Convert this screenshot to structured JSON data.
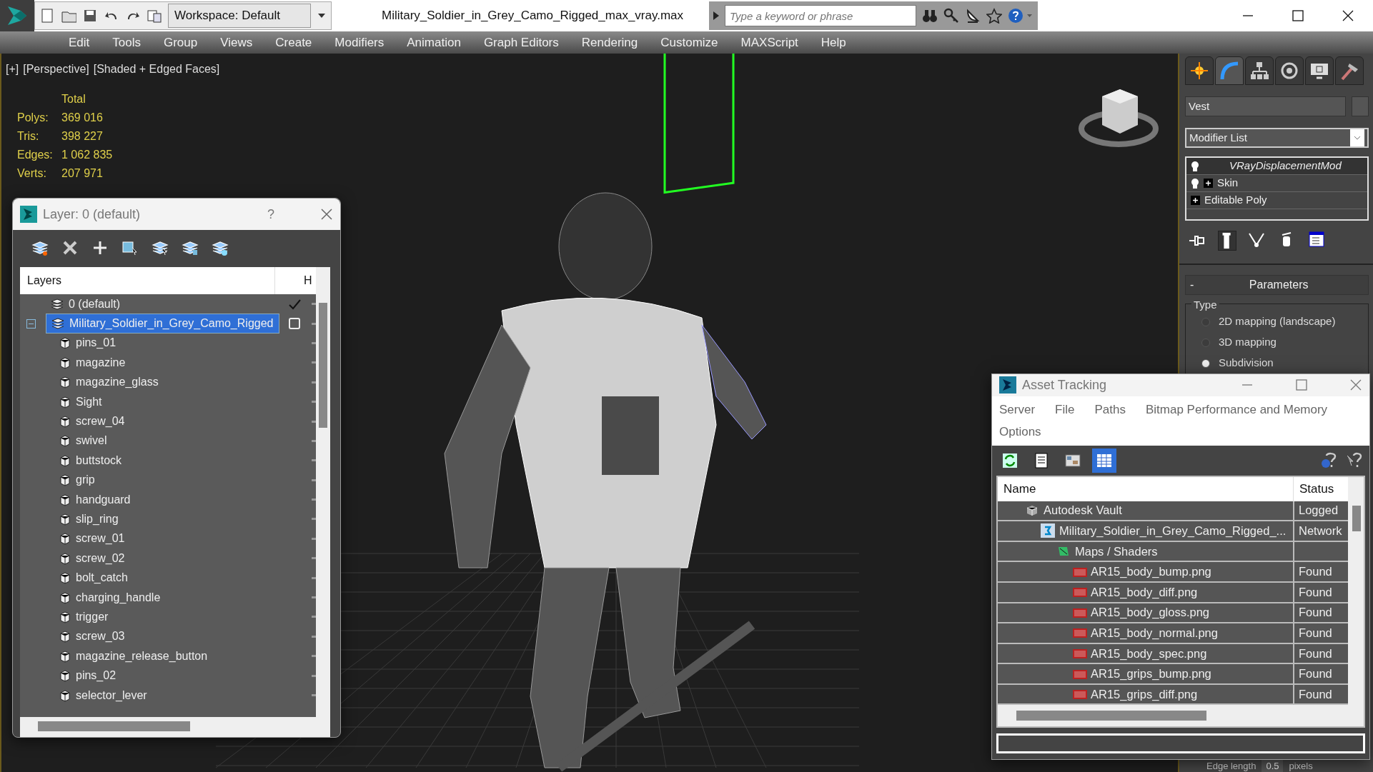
{
  "window": {
    "title": "Military_Soldier_in_Grey_Camo_Rigged_max_vray.max",
    "workspace": "Workspace: Default",
    "search_placeholder": "Type a keyword or phrase"
  },
  "menu": [
    "Edit",
    "Tools",
    "Group",
    "Views",
    "Create",
    "Modifiers",
    "Animation",
    "Graph Editors",
    "Rendering",
    "Customize",
    "MAXScript",
    "Help"
  ],
  "viewport": {
    "labels": [
      "[+]",
      "[Perspective]",
      "[Shaded + Edged Faces]"
    ],
    "stats_header": "Total",
    "stats": [
      {
        "label": "Polys:",
        "value": "369 016"
      },
      {
        "label": "Tris:",
        "value": "398 227"
      },
      {
        "label": "Edges:",
        "value": "1 062 835"
      },
      {
        "label": "Verts:",
        "value": "207 971"
      }
    ]
  },
  "layer_dialog": {
    "title": "Layer: 0 (default)",
    "help": "?",
    "columns": [
      "Layers",
      "H"
    ],
    "layers": [
      {
        "name": "0 (default)",
        "selected": false,
        "current": true
      },
      {
        "name": "Military_Soldier_in_Grey_Camo_Rigged",
        "selected": true,
        "current": false,
        "expanded": true,
        "children": [
          {
            "name": "pins_01"
          },
          {
            "name": "magazine"
          },
          {
            "name": "magazine_glass"
          },
          {
            "name": "Sight"
          },
          {
            "name": "screw_04"
          },
          {
            "name": "swivel"
          },
          {
            "name": "buttstock"
          },
          {
            "name": "grip"
          },
          {
            "name": "handguard"
          },
          {
            "name": "slip_ring"
          },
          {
            "name": "screw_01"
          },
          {
            "name": "screw_02"
          },
          {
            "name": "bolt_catch"
          },
          {
            "name": "charging_handle"
          },
          {
            "name": "trigger"
          },
          {
            "name": "screw_03"
          },
          {
            "name": "magazine_release_button"
          },
          {
            "name": "pins_02"
          },
          {
            "name": "selector_lever"
          }
        ]
      }
    ]
  },
  "command_panel": {
    "tabs": [
      {
        "selected": false
      },
      {
        "selected": true
      },
      {
        "selected": false
      },
      {
        "selected": false
      },
      {
        "selected": false
      },
      {
        "selected": false
      }
    ],
    "object_name": "Vest",
    "modifier_list": "Modifier List",
    "stack": [
      {
        "name": "VRayDisplacementMod",
        "kind": "modifier",
        "selected": true,
        "render_only": true,
        "expandable": false
      },
      {
        "name": "Skin",
        "kind": "modifier",
        "selected": false,
        "render_only": false,
        "expandable": true
      },
      {
        "name": "Editable Poly",
        "kind": "base",
        "selected": false,
        "render_only": false,
        "expandable": true
      }
    ],
    "rollout": {
      "toggle": "-",
      "title": "Parameters",
      "group": "Type",
      "options": [
        {
          "label": "2D mapping (landscape)",
          "selected": false
        },
        {
          "label": "3D mapping",
          "selected": false
        },
        {
          "label": "Subdivision",
          "selected": true
        }
      ]
    },
    "edge_length": {
      "label": "Edge length",
      "value": "0.5",
      "unit": "pixels"
    }
  },
  "asset_tracking": {
    "title": "Asset Tracking",
    "menu": [
      "Server",
      "File",
      "Paths",
      "Bitmap Performance and Memory",
      "Options"
    ],
    "tools": [
      {
        "selected": false
      },
      {
        "selected": false
      },
      {
        "selected": false
      },
      {
        "selected": true
      }
    ],
    "columns": [
      "Name",
      "Status"
    ],
    "rows": [
      {
        "name": "Autodesk Vault",
        "status": "Logged",
        "kind": "vault",
        "children": [
          {
            "name": "Military_Soldier_in_Grey_Camo_Rigged_...",
            "status": "Network",
            "kind": "scene",
            "children": [
              {
                "name": "Maps / Shaders",
                "kind": "folder",
                "children": [
                  {
                    "name": "AR15_body_bump.png",
                    "status": "Found",
                    "kind": "png"
                  },
                  {
                    "name": "AR15_body_diff.png",
                    "status": "Found",
                    "kind": "png"
                  },
                  {
                    "name": "AR15_body_gloss.png",
                    "status": "Found",
                    "kind": "png"
                  },
                  {
                    "name": "AR15_body_normal.png",
                    "status": "Found",
                    "kind": "png"
                  },
                  {
                    "name": "AR15_body_spec.png",
                    "status": "Found",
                    "kind": "png"
                  },
                  {
                    "name": "AR15_grips_bump.png",
                    "status": "Found",
                    "kind": "png"
                  },
                  {
                    "name": "AR15_grips_diff.png",
                    "status": "Found",
                    "kind": "png"
                  }
                ]
              }
            ]
          }
        ]
      }
    ]
  }
}
